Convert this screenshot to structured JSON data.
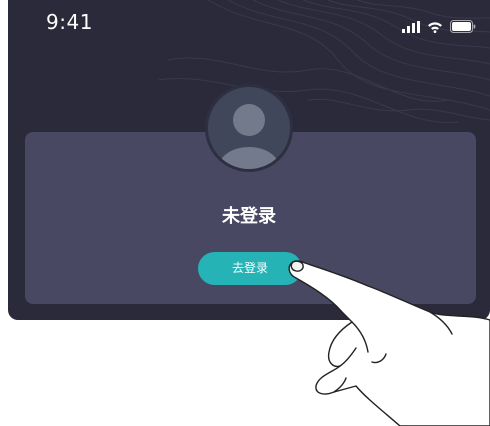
{
  "status_bar": {
    "time": "9:41",
    "icons": [
      "signal-icon",
      "wifi-icon",
      "battery-icon"
    ]
  },
  "profile": {
    "avatar_icon": "user-avatar-icon",
    "name": "未登录"
  },
  "login_button": {
    "label": "去登录"
  },
  "colors": {
    "background": "#2b2a3a",
    "card": "#484863",
    "accent": "#25b3b6",
    "text": "#ffffff"
  }
}
